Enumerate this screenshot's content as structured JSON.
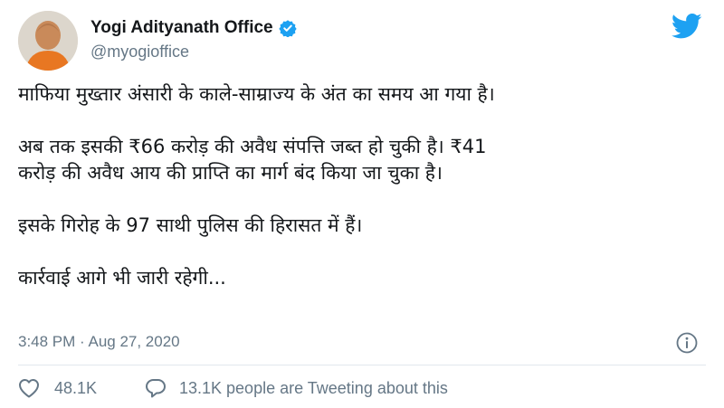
{
  "author": {
    "display_name": "Yogi Adityanath Office",
    "handle": "@myogioffice",
    "verified": true
  },
  "tweet": {
    "paragraphs": [
      "माफिया मुख्तार अंसारी के काले-साम्राज्य के अंत का समय आ गया है।",
      "अब तक इसकी ₹66 करोड़ की अवैध संपत्ति जब्त हो चुकी है। ₹41\nकरोड़ की अवैध आय की प्राप्ति का मार्ग बंद किया जा चुका है।",
      "इसके गिरोह के 97 साथी पुलिस की हिरासत में हैं।",
      "कार्रवाई आगे भी जारी रहेगी..."
    ],
    "timestamp": "3:48 PM · Aug 27, 2020"
  },
  "actions": {
    "like_count": "48.1K",
    "reply_text": "13.1K people are Tweeting about this"
  },
  "icons": {
    "verified": "verified-badge-icon",
    "logo": "twitter-bird-icon",
    "info": "info-icon",
    "like": "heart-icon",
    "reply": "speech-bubble-icon"
  },
  "colors": {
    "accent": "#1da1f2",
    "text": "#14171a",
    "muted": "#657786",
    "divider": "#e1e8ed"
  }
}
